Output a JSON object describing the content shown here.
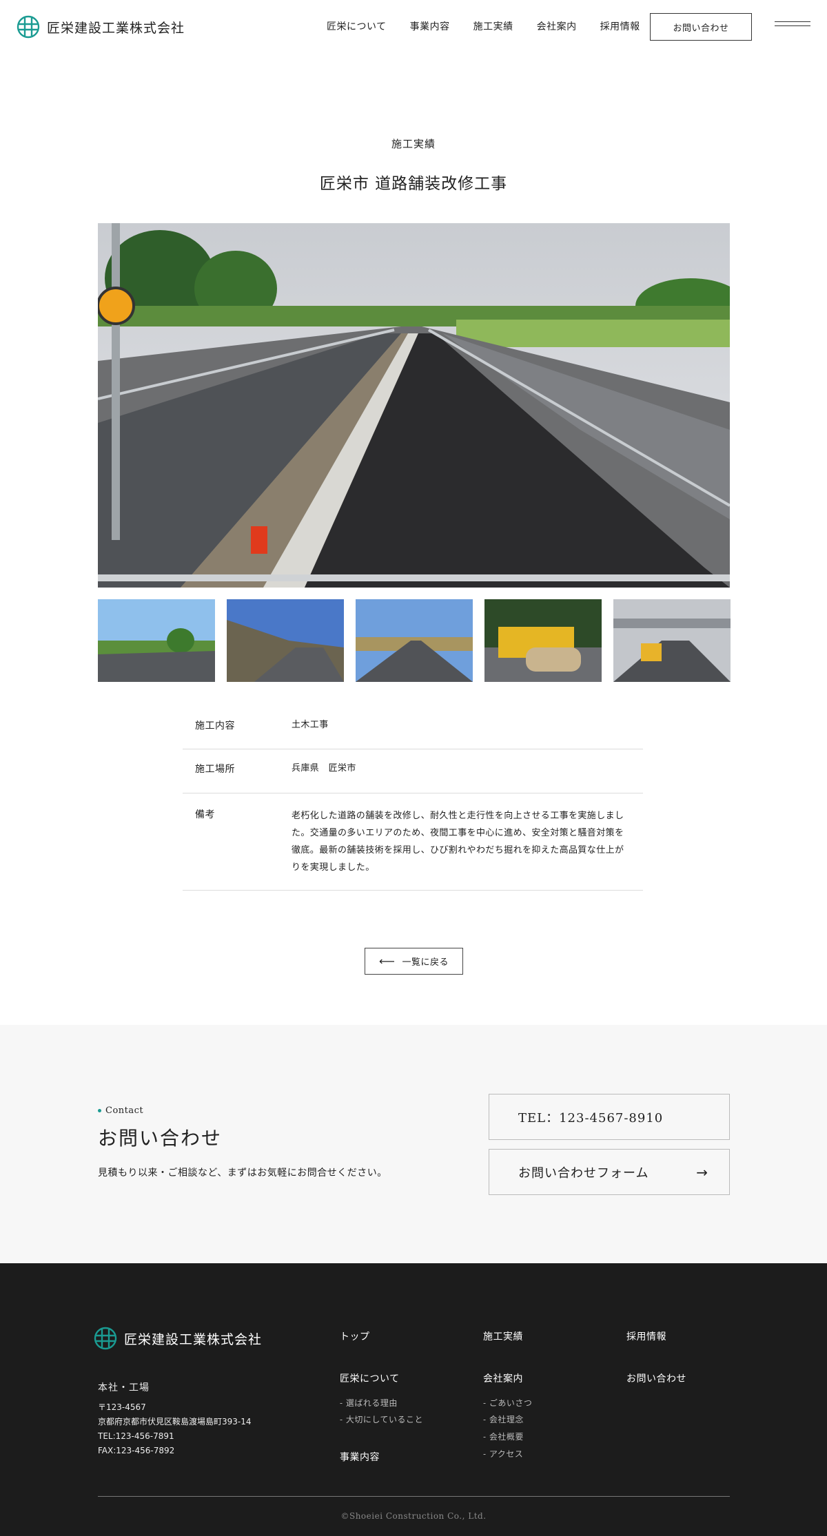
{
  "header": {
    "logo_text": "匠栄建設工業株式会社",
    "nav": [
      "匠栄について",
      "事業内容",
      "施工実績",
      "会社案内",
      "採用情報"
    ],
    "contact_button": "お問い合わせ"
  },
  "page": {
    "section_label": "施工実績",
    "title": "匠栄市 道路舗装改修工事"
  },
  "details": [
    {
      "label": "施工内容",
      "value": "土木工事"
    },
    {
      "label": "施工場所",
      "value": "兵庫県　匠栄市"
    },
    {
      "label": "備考",
      "value": "老朽化した道路の舗装を改修し、耐久性と走行性を向上させる工事を実施しました。交通量の多いエリアのため、夜間工事を中心に進め、安全対策と騒音対策を徹底。最新の舗装技術を採用し、ひび割れやわだち掘れを抑えた高品質な仕上がりを実現しました。"
    }
  ],
  "back_button": "一覧に戻る",
  "contact": {
    "label": "Contact",
    "heading": "お問い合わせ",
    "description": "見積もり以来・ご相談など、まずはお気軽にお問合せください。",
    "tel": "TEL：123-4567-8910",
    "form": "お問い合わせフォーム"
  },
  "footer": {
    "logo_text": "匠栄建設工業株式会社",
    "address_title": "本社・工場",
    "address_lines": [
      "〒123-4567",
      "京都府京都市伏見区鞍島渡場島町393-14",
      "TEL:123-456-7891",
      "FAX:123-456-7892"
    ],
    "links": {
      "top": "トップ",
      "about": "匠栄について",
      "about_sub": [
        "- 選ばれる理由",
        "- 大切にしていること"
      ],
      "business": "事業内容",
      "works": "施工実績",
      "company": "会社案内",
      "company_sub": [
        "- ごあいさつ",
        "- 会社理念",
        "- 会社概要",
        "- アクセス"
      ],
      "recruit": "採用情報",
      "contact": "お問い合わせ"
    },
    "copyright": "©Shoeiei Construction Co., Ltd."
  },
  "colors": {
    "accent": "#1a9b92",
    "footer_bg": "#1c1c1c",
    "contact_bg": "#f7f7f7"
  }
}
